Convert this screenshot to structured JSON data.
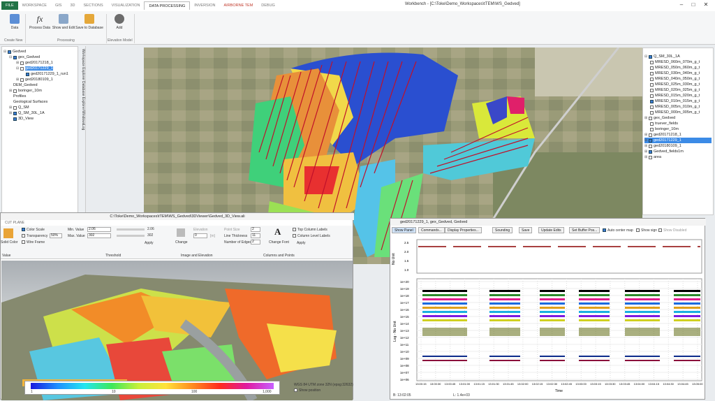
{
  "titlebar": {
    "tabs": [
      "FILE",
      "WORKSPACE",
      "GIS",
      "3D",
      "SECTIONS",
      "VISUALIZATION",
      "DATA PROCESSING",
      "INVERSION",
      "AIRBORNE TEM",
      "DEBUG"
    ],
    "window_title": "Workbench - [C:\\Toke\\Demo_Workspaces\\tTEM\\WS_Gedved]",
    "minimize": "–",
    "maximize": "□",
    "close": "✕"
  },
  "ribbon": {
    "buttons": [
      {
        "label": "Data"
      },
      {
        "label": "Process Data"
      },
      {
        "label": "Show and Edit"
      },
      {
        "label": "Save to Database"
      },
      {
        "label": "Add"
      }
    ],
    "groups": [
      "Create New",
      "Processing",
      "Elevation Model"
    ]
  },
  "left_tree": {
    "items": [
      {
        "label": "Gedved"
      },
      {
        "label": "gex_Gedved"
      },
      {
        "label": "ged20171218_1"
      },
      {
        "label": "ged20171229_1"
      },
      {
        "label": "ged20171229_1_run1"
      },
      {
        "label": "ged20180109_1"
      },
      {
        "label": "DEM_Gedved"
      },
      {
        "label": "boringer_10m"
      },
      {
        "label": "Profiles"
      },
      {
        "label": "Geological Surfaces"
      },
      {
        "label": "Q_SM"
      },
      {
        "label": "Q_SM_30L_1A"
      },
      {
        "label": "3D_View"
      }
    ]
  },
  "vertical_tabs": [
    "Workspace Explorer",
    "Database Explorer",
    "Windows",
    "Log"
  ],
  "right_tree": {
    "items": [
      {
        "label": "Q_SM_30L_1A"
      },
      {
        "label": "MRESD_060m_070m_g_t"
      },
      {
        "label": "MRESD_050m_060m_g_t"
      },
      {
        "label": "MRESD_030m_040m_g_t"
      },
      {
        "label": "MRESD_040m_050m_g_t"
      },
      {
        "label": "MRESD_025m_030m_g_t"
      },
      {
        "label": "MRESD_020m_025m_g_t"
      },
      {
        "label": "MRESD_015m_020m_g_t"
      },
      {
        "label": "MRESD_010m_015m_g_t"
      },
      {
        "label": "MRESD_005m_010m_g_t"
      },
      {
        "label": "MRESD_000m_005m_g_t"
      },
      {
        "label": "gex_Gedved"
      },
      {
        "label": "truever_fields"
      },
      {
        "label": "boringer_10m"
      },
      {
        "label": "ged20171218_1"
      },
      {
        "label": "ged20171229_1"
      },
      {
        "label": "ged20180109_1"
      },
      {
        "label": "Gedved_fields1m"
      },
      {
        "label": "area"
      }
    ]
  },
  "view3d": {
    "title": "C:\\Toke\\Demo_Workspaces\\tTEM\\WS_Gedved\\3DViewer\\Gedved_3D_View.ali",
    "tab": "CUT PLANE",
    "solid_color": "Solid Color",
    "color_scale": "Color Scale",
    "transparency": "Transparency",
    "transparency_value": "50%",
    "wire_frame": "Wire Frame",
    "group_value": "Value",
    "min_label": "Min. Value",
    "min_value": "2.06",
    "max_label": "Max. Value",
    "max_value": "302",
    "slider_min": "2.06",
    "slider_max": "302",
    "apply": "Apply",
    "group_threshold": "Threshold",
    "change": "Change",
    "elevation": "Elevation",
    "elevation_value": "0",
    "elevation_unit": "[m]",
    "group_image": "Image and Elevation",
    "point_size": "Point Size",
    "point_size_value": "2",
    "line_thickness": "Line Thickness",
    "line_thickness_value": "11",
    "edges": "Number of Edges",
    "edges_value": "2",
    "change_font": "Change Font",
    "top_labels": "Top Column Labels",
    "level_labels": "Column Level Labels",
    "apply2": "Apply",
    "group_columns": "Columns and Points",
    "colorbar_ticks": [
      "1",
      "10",
      "100",
      "1,000"
    ],
    "projection": "WGS 84 UTM zone 32N (epsg:32632)",
    "show_position": "Show position"
  },
  "plot": {
    "title": "ged20171229_1, gex_Gedved, Gedved",
    "buttons": [
      "Show Panel",
      "Commands...",
      "Display Properties...",
      "Sounding",
      "Save",
      "Update Edits",
      "Set Buffer Pos..."
    ],
    "checks": [
      "Auto center map",
      "Show sign",
      "Show Disabled"
    ],
    "status_left": "B: 13:02:05",
    "status_mid": "L: 1.4e+03",
    "chart_data": {
      "type": "scatter",
      "top_panel": {
        "ylabel": "No Unit",
        "yticks": [
          "2.5",
          "2.0",
          "1.5",
          "1.0"
        ]
      },
      "bottom_panel": {
        "ylabel": "Log - No Unit",
        "yticks": [
          "1e+20",
          "1e+19",
          "1e+18",
          "1e+17",
          "1e+16",
          "1e+15",
          "1e+14",
          "1e+13",
          "1e+12",
          "1e+11",
          "1e+10",
          "1e+09",
          "1e+08",
          "1e+07",
          "1e+06"
        ],
        "xlabel": "Time",
        "xticks": [
          "13:00:15",
          "13:00:30",
          "13:00:45",
          "13:01:00",
          "13:01:15",
          "13:01:30",
          "13:01:45",
          "13:02:00",
          "13:02:15",
          "13:02:30",
          "13:02:45",
          "13:03:00",
          "13:03:15",
          "13:03:30",
          "13:03:45",
          "13:04:00",
          "13:04:15",
          "13:04:30",
          "13:04:45",
          "13:05:00"
        ]
      }
    }
  }
}
